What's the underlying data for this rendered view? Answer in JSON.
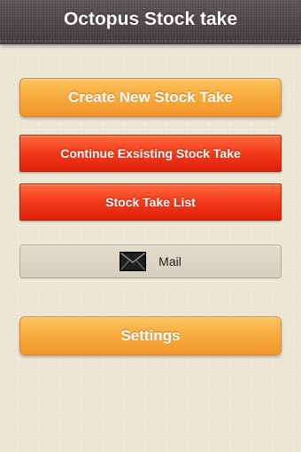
{
  "header": {
    "title": "Octopus Stock take"
  },
  "menu": {
    "create_label": "Create New Stock Take",
    "continue_label": "Continue Exsisting Stock Take",
    "list_label": "Stock Take List",
    "mail_label": "Mail",
    "mail_icon": "envelope-icon",
    "settings_label": "Settings"
  },
  "colors": {
    "header_bg": "#4a4446",
    "primary_button": "#f7aa3b",
    "secondary_button": "#e8301a",
    "mail_button": "#ddd5c5",
    "background": "#eee6d4"
  }
}
